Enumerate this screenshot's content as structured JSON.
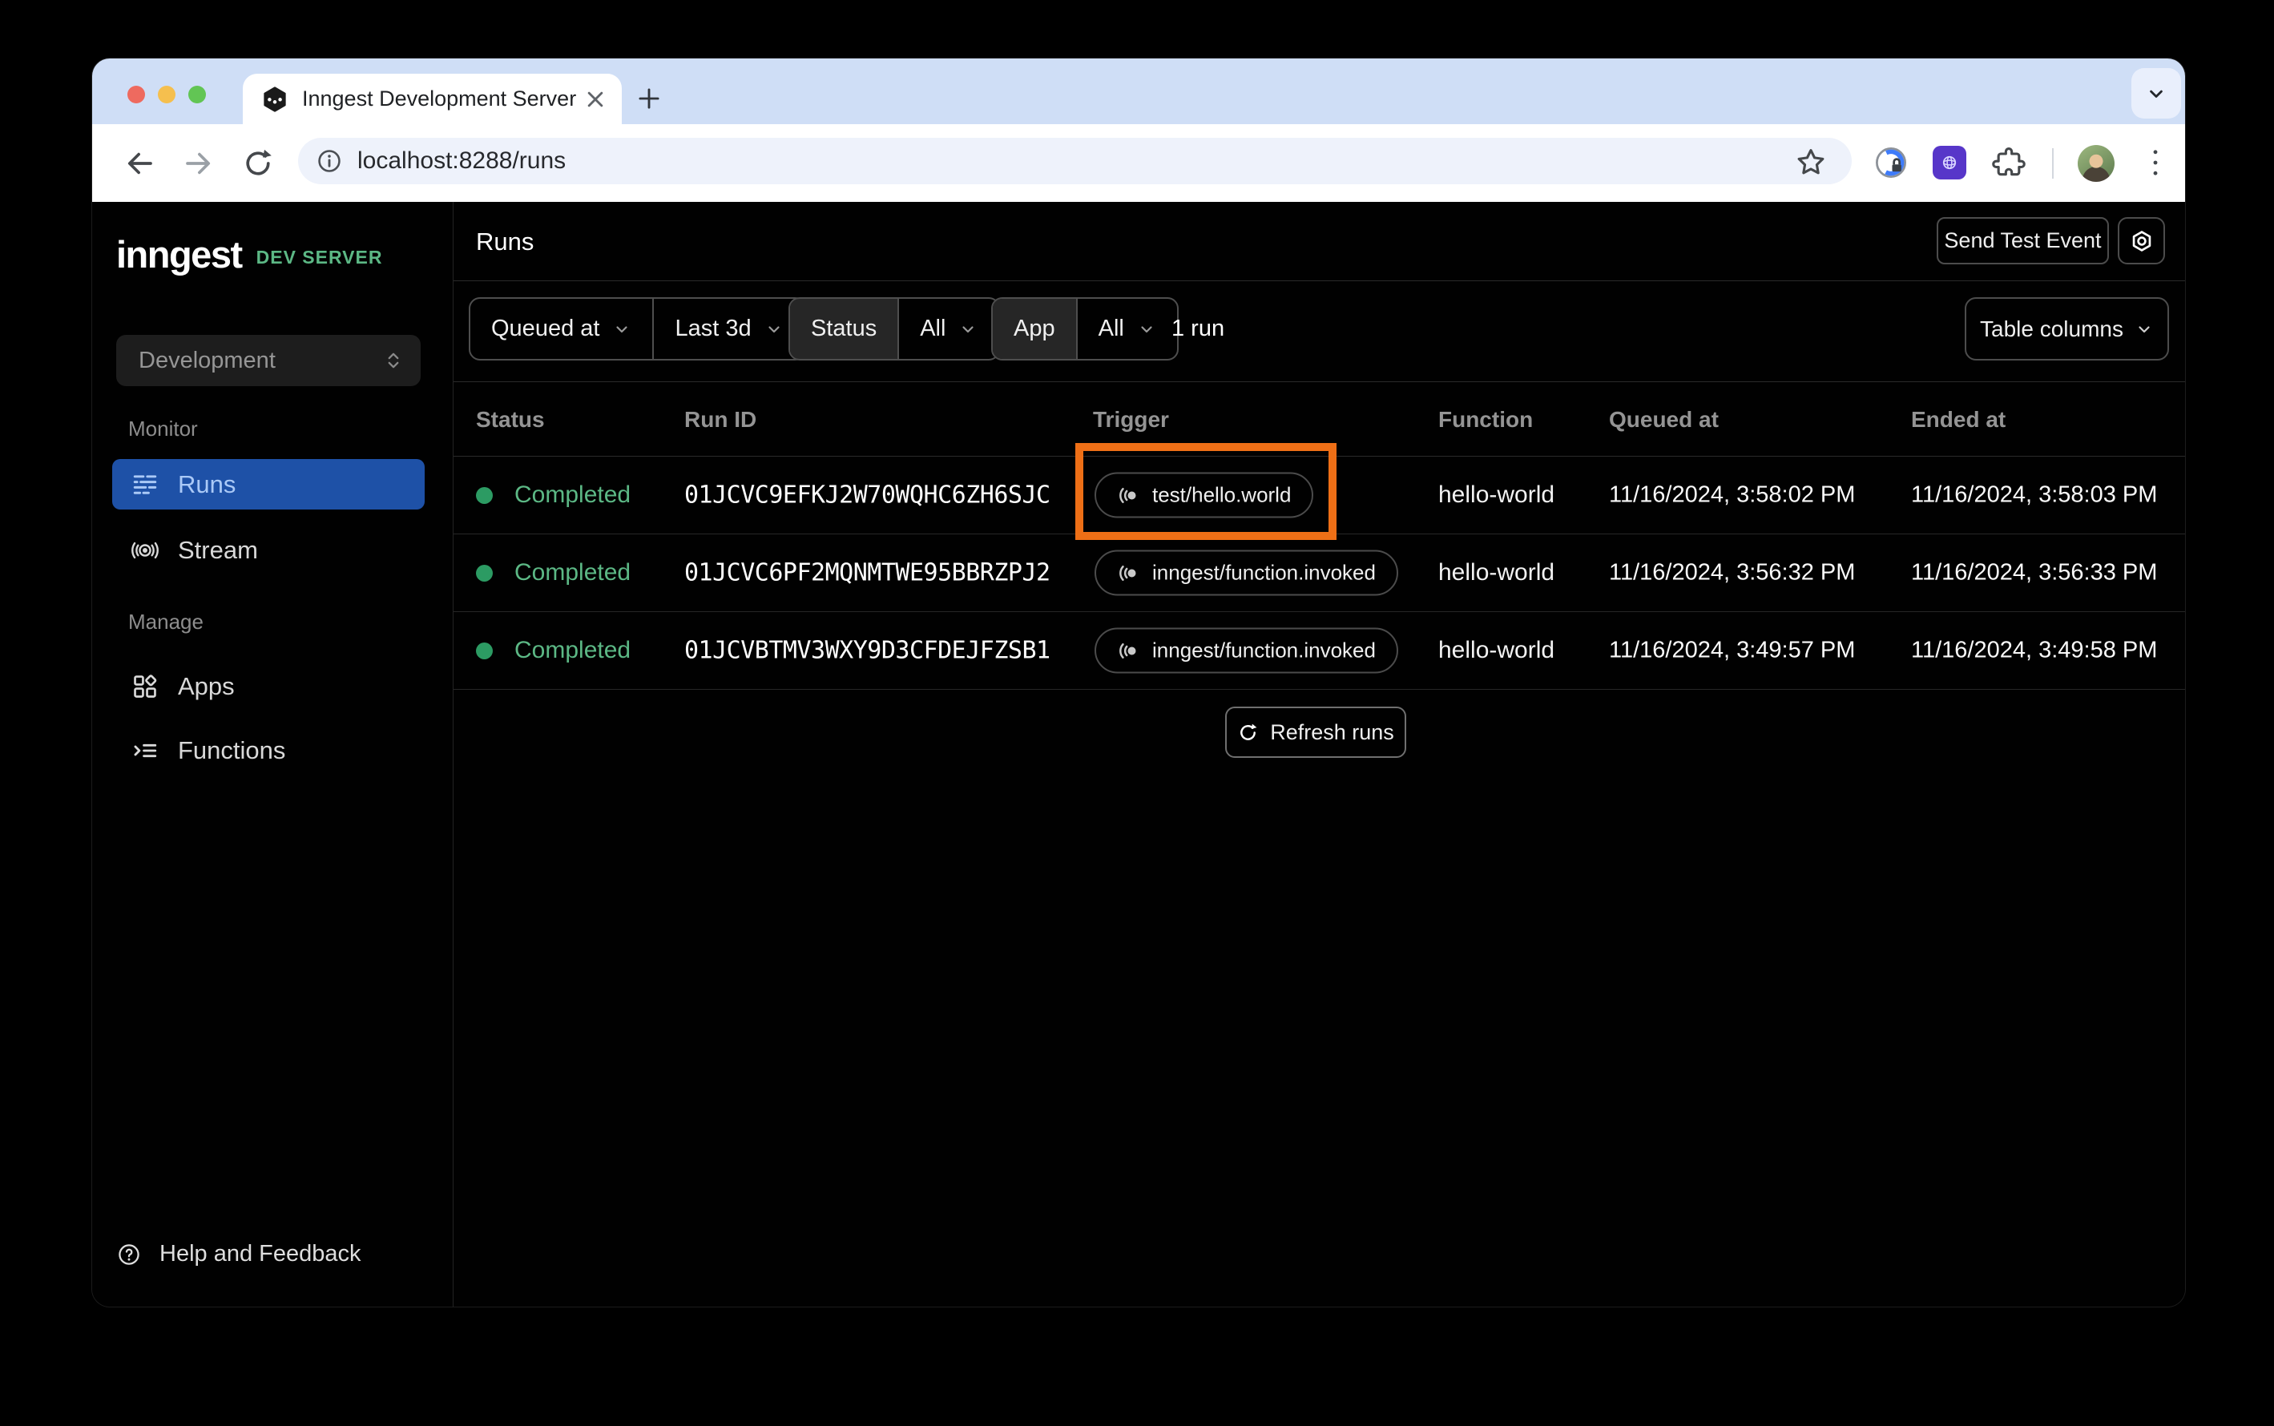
{
  "browser": {
    "tab_title": "Inngest Development Server",
    "url": "localhost:8288/runs"
  },
  "sidebar": {
    "logo": "inngest",
    "badge": "DEV SERVER",
    "environment": "Development",
    "monitor_label": "Monitor",
    "runs_label": "Runs",
    "stream_label": "Stream",
    "manage_label": "Manage",
    "apps_label": "Apps",
    "functions_label": "Functions",
    "help_label": "Help and Feedback"
  },
  "header": {
    "title": "Runs",
    "send_test_event": "Send Test Event"
  },
  "filters": {
    "queued_at": "Queued at",
    "time_range": "Last 3d",
    "status_label": "Status",
    "status_value": "All",
    "app_label": "App",
    "app_value": "All",
    "run_count": "1 run",
    "table_columns": "Table columns"
  },
  "table": {
    "columns": [
      "Status",
      "Run ID",
      "Trigger",
      "Function",
      "Queued at",
      "Ended at"
    ],
    "rows": [
      {
        "status": "Completed",
        "run_id": "01JCVC9EFKJ2W70WQHC6ZH6SJC",
        "trigger": "test/hello.world",
        "function": "hello-world",
        "queued_at": "11/16/2024, 3:58:02 PM",
        "ended_at": "11/16/2024, 3:58:03 PM",
        "highlighted": true
      },
      {
        "status": "Completed",
        "run_id": "01JCVC6PF2MQNMTWE95BBRZPJ2",
        "trigger": "inngest/function.invoked",
        "function": "hello-world",
        "queued_at": "11/16/2024, 3:56:32 PM",
        "ended_at": "11/16/2024, 3:56:33 PM",
        "highlighted": false
      },
      {
        "status": "Completed",
        "run_id": "01JCVBTMV3WXY9D3CFDEJFZSB1",
        "trigger": "inngest/function.invoked",
        "function": "hello-world",
        "queued_at": "11/16/2024, 3:49:57 PM",
        "ended_at": "11/16/2024, 3:49:58 PM",
        "highlighted": false
      }
    ],
    "refresh": "Refresh runs"
  },
  "colors": {
    "accent_green": "#5CB885",
    "status_dot_green": "#2C9B63",
    "selected_blue": "#1E51A7",
    "annotation_orange": "#EE6F16"
  }
}
